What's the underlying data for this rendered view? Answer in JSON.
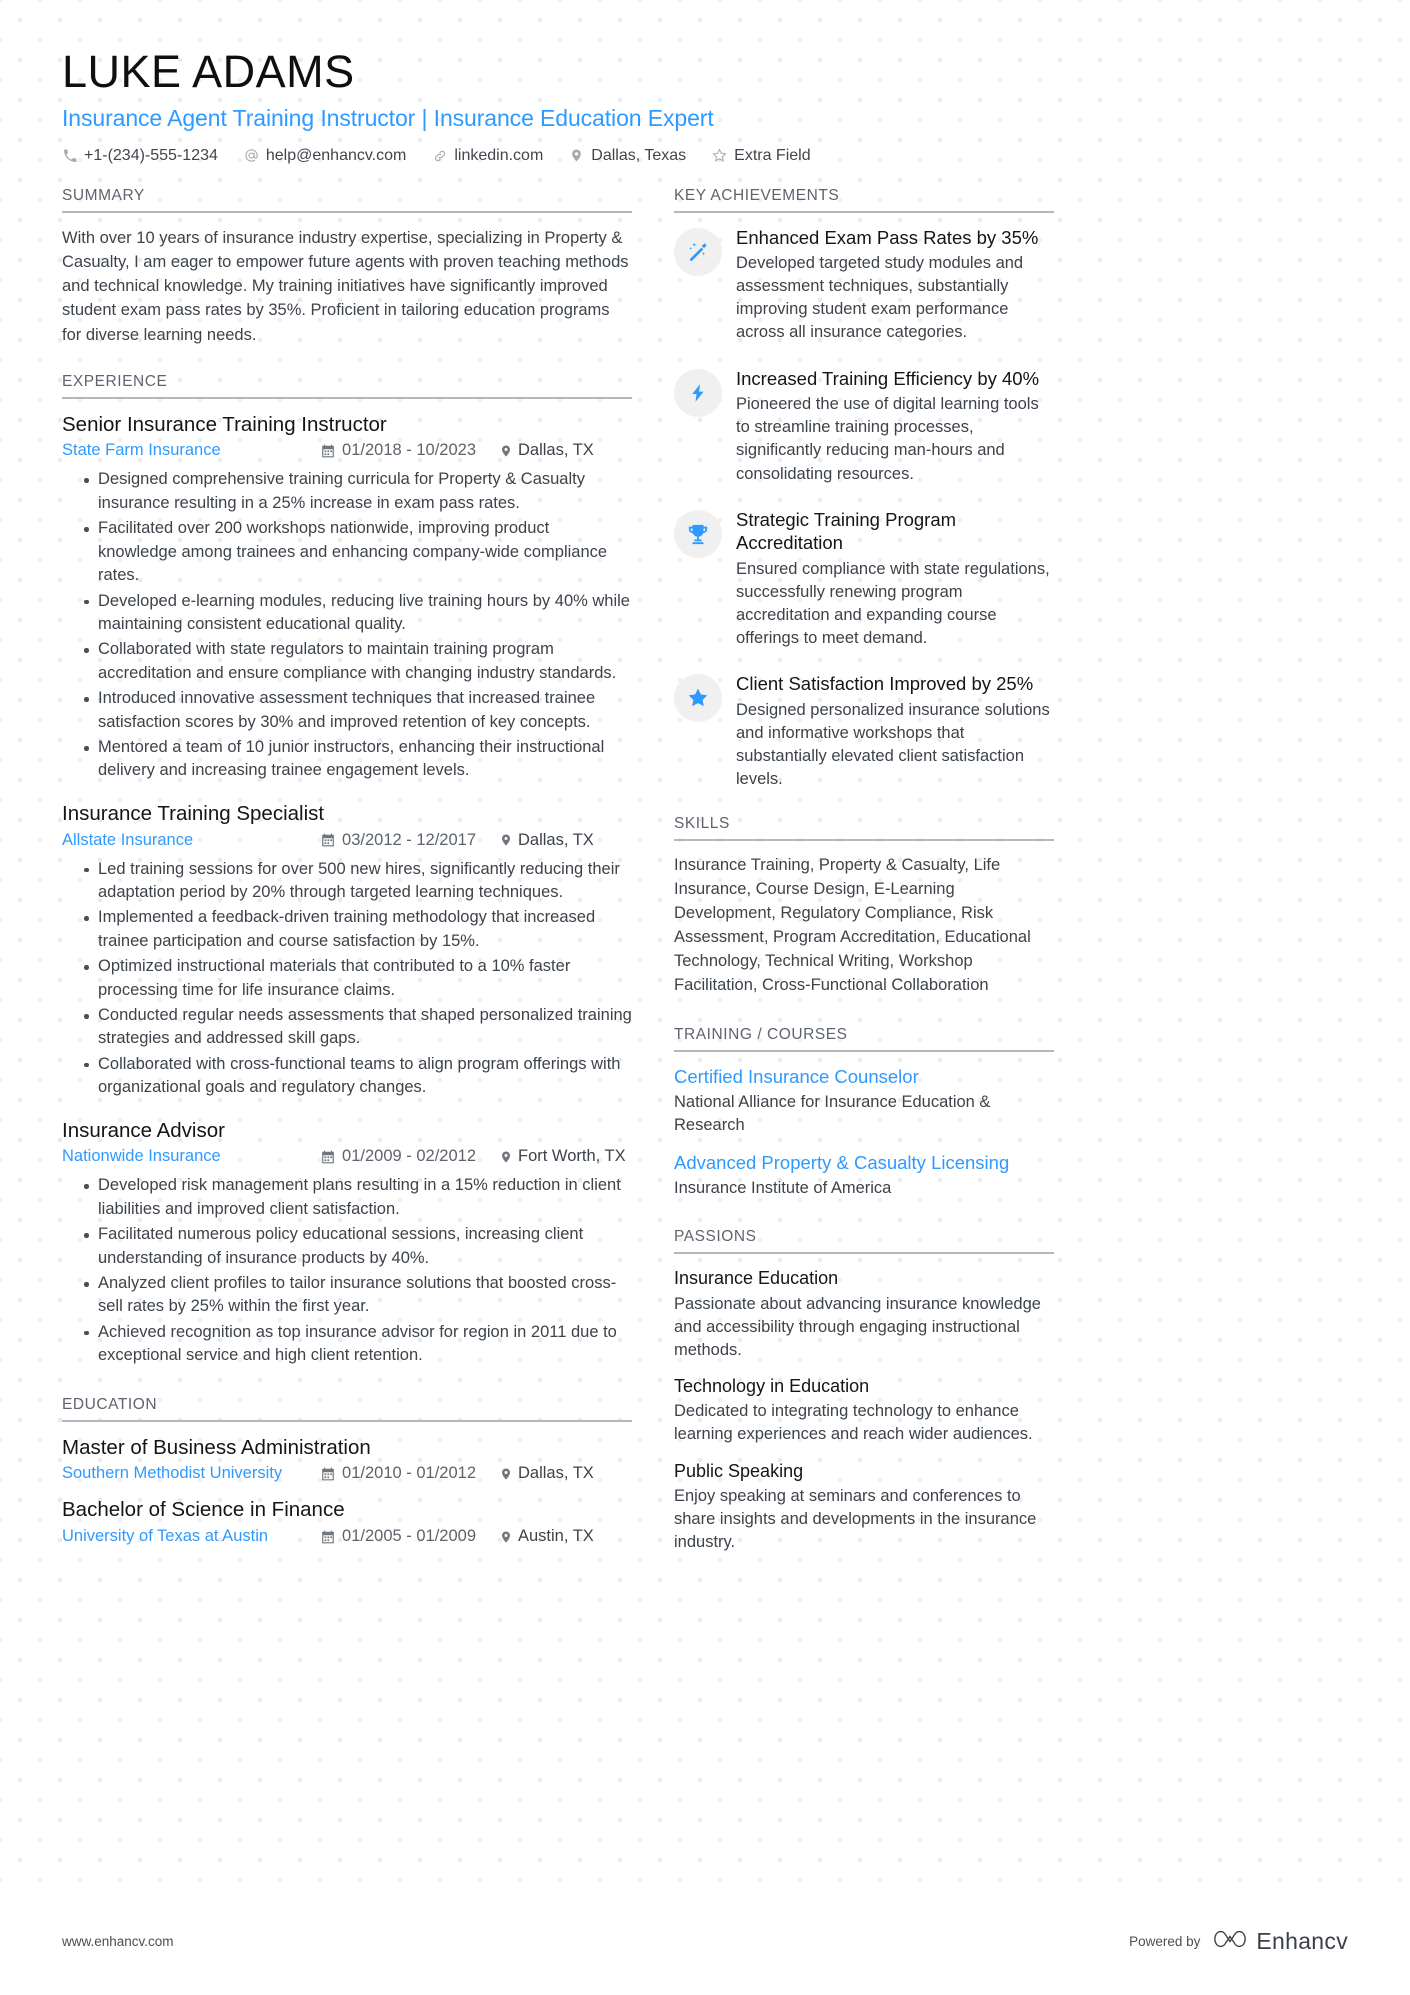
{
  "header": {
    "name": "LUKE ADAMS",
    "headline": "Insurance Agent Training Instructor | Insurance Education Expert",
    "contacts": [
      {
        "icon": "phone-icon",
        "text": "+1-(234)-555-1234"
      },
      {
        "icon": "at-email-icon",
        "text": "help@enhancv.com"
      },
      {
        "icon": "link-icon",
        "text": "linkedin.com"
      },
      {
        "icon": "location-pin-icon",
        "text": "Dallas, Texas"
      },
      {
        "icon": "star-icon",
        "text": "Extra Field"
      }
    ]
  },
  "sections": {
    "summary_title": "SUMMARY",
    "experience_title": "EXPERIENCE",
    "education_title": "EDUCATION",
    "achievements_title": "KEY ACHIEVEMENTS",
    "skills_title": "SKILLS",
    "training_title": "TRAINING / COURSES",
    "passions_title": "PASSIONS"
  },
  "summary": {
    "text": "With over 10 years of insurance industry expertise, specializing in Property & Casualty, I am eager to empower future agents with proven teaching methods and technical knowledge. My training initiatives have significantly improved student exam pass rates by 35%. Proficient in tailoring education programs for diverse learning needs."
  },
  "experience": [
    {
      "title": "Senior Insurance Training Instructor",
      "company": "State Farm Insurance",
      "date": "01/2018 - 10/2023",
      "location": "Dallas, TX",
      "bullets": [
        "Designed comprehensive training curricula for Property & Casualty insurance resulting in a 25% increase in exam pass rates.",
        "Facilitated over 200 workshops nationwide, improving product knowledge among trainees and enhancing company-wide compliance rates.",
        "Developed e-learning modules, reducing live training hours by 40% while maintaining consistent educational quality.",
        "Collaborated with state regulators to maintain training program accreditation and ensure compliance with changing industry standards.",
        "Introduced innovative assessment techniques that increased trainee satisfaction scores by 30% and improved retention of key concepts.",
        "Mentored a team of 10 junior instructors, enhancing their instructional delivery and increasing trainee engagement levels."
      ]
    },
    {
      "title": "Insurance Training Specialist",
      "company": "Allstate Insurance",
      "date": "03/2012 - 12/2017",
      "location": "Dallas, TX",
      "bullets": [
        "Led training sessions for over 500 new hires, significantly reducing their adaptation period by 20% through targeted learning techniques.",
        "Implemented a feedback-driven training methodology that increased trainee participation and course satisfaction by 15%.",
        "Optimized instructional materials that contributed to a 10% faster processing time for life insurance claims.",
        "Conducted regular needs assessments that shaped personalized training strategies and addressed skill gaps.",
        "Collaborated with cross-functional teams to align program offerings with organizational goals and regulatory changes."
      ]
    },
    {
      "title": "Insurance Advisor",
      "company": "Nationwide Insurance",
      "date": "01/2009 - 02/2012",
      "location": "Fort Worth, TX",
      "bullets": [
        "Developed risk management plans resulting in a 15% reduction in client liabilities and improved client satisfaction.",
        "Facilitated numerous policy educational sessions, increasing client understanding of insurance products by 40%.",
        "Analyzed client profiles to tailor insurance solutions that boosted cross-sell rates by 25% within the first year.",
        "Achieved recognition as top insurance advisor for region in 2011 due to exceptional service and high client retention."
      ]
    }
  ],
  "education": [
    {
      "degree": "Master of Business Administration",
      "school": "Southern Methodist University",
      "date": "01/2010 - 01/2012",
      "location": "Dallas, TX"
    },
    {
      "degree": "Bachelor of Science in Finance",
      "school": "University of Texas at Austin",
      "date": "01/2005 - 01/2009",
      "location": "Austin, TX"
    }
  ],
  "achievements": [
    {
      "icon": "magic-wand-icon",
      "title": "Enhanced Exam Pass Rates by 35%",
      "desc": "Developed targeted study modules and assessment techniques, substantially improving student exam performance across all insurance categories."
    },
    {
      "icon": "lightning-bolt-icon",
      "title": "Increased Training Efficiency by 40%",
      "desc": "Pioneered the use of digital learning tools to streamline training processes, significantly reducing man-hours and consolidating resources."
    },
    {
      "icon": "trophy-icon",
      "title": "Strategic Training Program Accreditation",
      "desc": "Ensured compliance with state regulations, successfully renewing program accreditation and expanding course offerings to meet demand."
    },
    {
      "icon": "star-badge-icon",
      "title": "Client Satisfaction Improved by 25%",
      "desc": "Designed personalized insurance solutions and informative workshops that substantially elevated client satisfaction levels."
    }
  ],
  "skills": {
    "text": "Insurance Training, Property & Casualty, Life Insurance, Course Design, E-Learning Development, Regulatory Compliance, Risk Assessment, Program Accreditation, Educational Technology, Technical Writing, Workshop Facilitation, Cross-Functional Collaboration"
  },
  "training": [
    {
      "name": "Certified Insurance Counselor",
      "org": "National Alliance for Insurance Education & Research"
    },
    {
      "name": "Advanced Property & Casualty Licensing",
      "org": "Insurance Institute of America"
    }
  ],
  "passions": [
    {
      "name": "Insurance Education",
      "desc": "Passionate about advancing insurance knowledge and accessibility through engaging instructional methods."
    },
    {
      "name": "Technology in Education",
      "desc": "Dedicated to integrating technology to enhance learning experiences and reach wider audiences."
    },
    {
      "name": "Public Speaking",
      "desc": "Enjoy speaking at seminars and conferences to share insights and developments in the insurance industry."
    }
  ],
  "footer": {
    "url": "www.enhancv.com",
    "powered_by": "Powered by",
    "brand": "Enhancv"
  },
  "colors": {
    "accent": "#2e9aff",
    "text": "#3d434a",
    "heading": "#151515",
    "rule": "#b3b8bd"
  }
}
